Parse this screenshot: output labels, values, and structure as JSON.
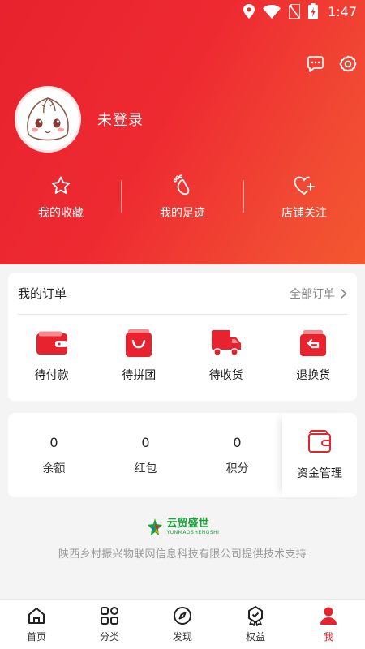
{
  "status_bar": {
    "time": "1:47"
  },
  "header": {
    "username": "未登录",
    "quick_links": [
      {
        "label": "我的收藏",
        "icon": "star-icon"
      },
      {
        "label": "我的足迹",
        "icon": "footprint-icon"
      },
      {
        "label": "店铺关注",
        "icon": "heart-plus-icon"
      }
    ]
  },
  "orders": {
    "title": "我的订单",
    "all_label": "全部订单",
    "items": [
      {
        "label": "待付款",
        "icon": "wallet-icon"
      },
      {
        "label": "待拼团",
        "icon": "shopping-bag-icon"
      },
      {
        "label": "待收货",
        "icon": "truck-icon"
      },
      {
        "label": "退换货",
        "icon": "return-icon"
      }
    ]
  },
  "wallet": {
    "items": [
      {
        "value": "0",
        "label": "余额"
      },
      {
        "value": "0",
        "label": "红包"
      },
      {
        "value": "0",
        "label": "积分"
      }
    ],
    "fund_label": "资金管理"
  },
  "brand": {
    "logo_cn": "云贸盛世",
    "logo_en": "YUNMAOSHENGSHI",
    "text": "陕西乡村振兴物联网信息科技有限公司提供技术支持"
  },
  "tabbar": {
    "tabs": [
      {
        "label": "首页",
        "icon": "home-icon"
      },
      {
        "label": "分类",
        "icon": "grid-icon"
      },
      {
        "label": "发现",
        "icon": "compass-icon"
      },
      {
        "label": "权益",
        "icon": "badge-icon"
      },
      {
        "label": "我",
        "icon": "user-icon",
        "active": true
      }
    ]
  },
  "colors": {
    "accent": "#e8222e",
    "accent_end": "#f4582f",
    "brand_green": "#1aa13a"
  }
}
